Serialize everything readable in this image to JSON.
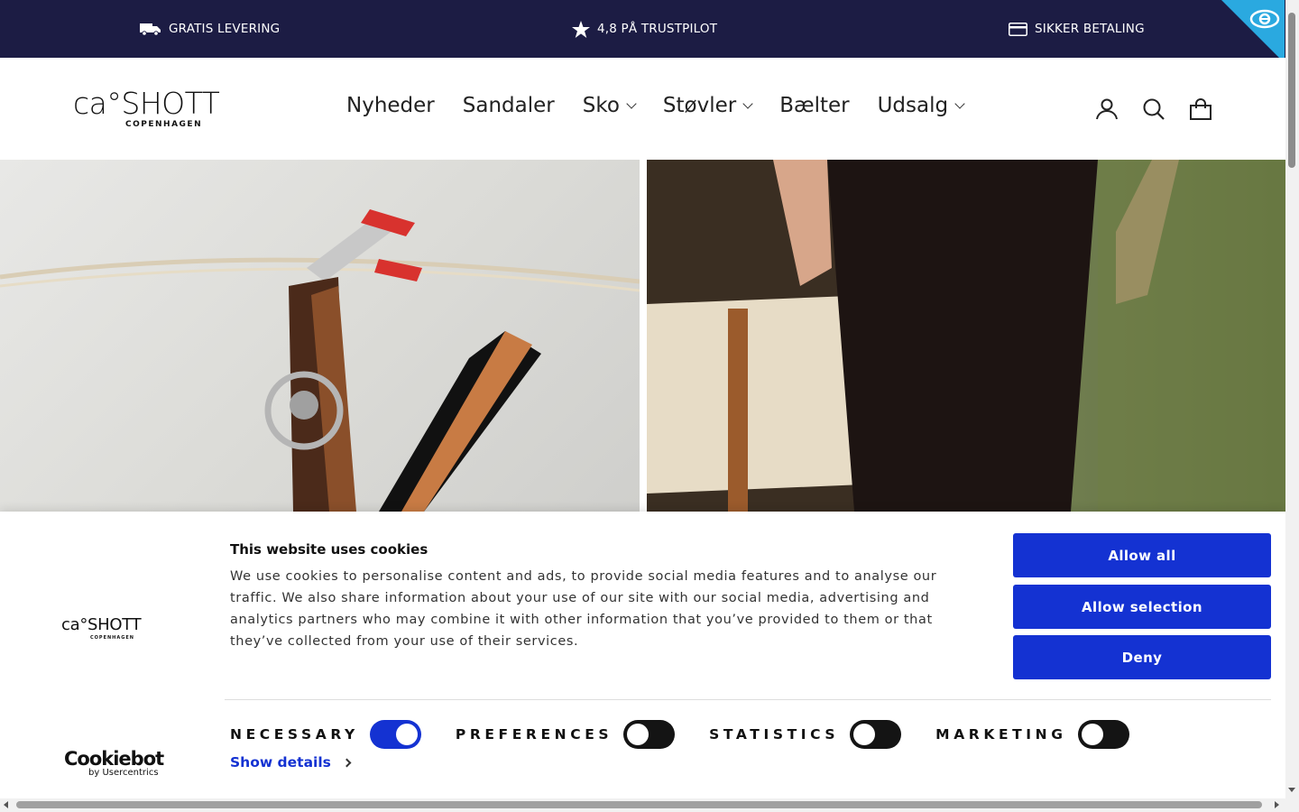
{
  "announcement": {
    "item1": "GRATIS LEVERING",
    "item2": "4,8 PÅ TRUSTPILOT",
    "item3": "SIKKER BETALING",
    "icons": [
      "truck-icon",
      "star-icon",
      "credit-card-icon"
    ],
    "bg_color": "#1c1c44"
  },
  "header": {
    "logo_main": "ca°SHOTT",
    "logo_sub": "COPENHAGEN",
    "nav": [
      {
        "label": "Nyheder",
        "dropdown": false
      },
      {
        "label": "Sandaler",
        "dropdown": false
      },
      {
        "label": "Sko",
        "dropdown": true
      },
      {
        "label": "Støvler",
        "dropdown": true
      },
      {
        "label": "Bælter",
        "dropdown": false
      },
      {
        "label": "Udsalg",
        "dropdown": true
      }
    ],
    "icons": [
      "account-icon",
      "search-icon",
      "cart-icon"
    ]
  },
  "cookie": {
    "logo_main": "ca°SHOTT",
    "logo_sub": "COPENHAGEN",
    "title": "This website uses cookies",
    "text": "We use cookies to personalise content and ads, to provide social media features and to analyse our traffic. We also share information about your use of our site with our social media, advertising and analytics partners who may combine it with other information that you’ve provided to them or that they’ve collected from your use of their services.",
    "buttons": {
      "allow_all": "Allow all",
      "allow_selection": "Allow selection",
      "deny": "Deny"
    },
    "toggles": [
      {
        "label": "NECESSARY",
        "on": true
      },
      {
        "label": "PREFERENCES",
        "on": false
      },
      {
        "label": "STATISTICS",
        "on": false
      },
      {
        "label": "MARKETING",
        "on": false
      }
    ],
    "show_details": "Show details",
    "cookiebot_main": "Cookiebot",
    "cookiebot_sub": "by Usercentrics",
    "accent_color": "#1432d2"
  }
}
